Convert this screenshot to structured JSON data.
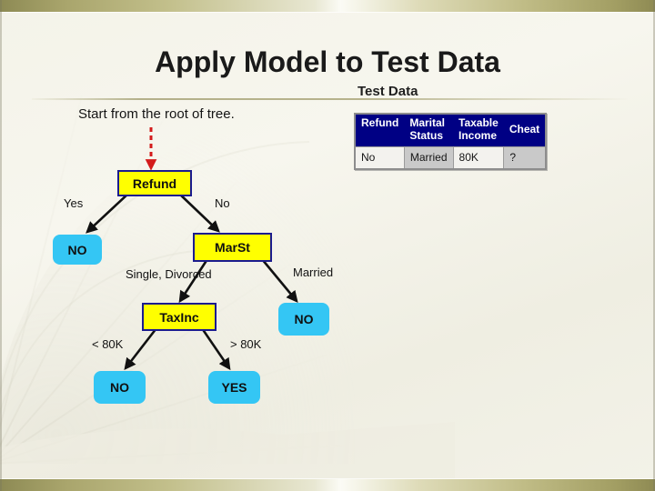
{
  "slide": {
    "title": "Apply Model to Test Data",
    "subtitle": "Test Data",
    "note": "Start from the root of tree.",
    "colors": {
      "background": "#f4f3e9",
      "band": "#a9a56c",
      "decision_fill": "#ffff00",
      "decision_border": "#1b1b8f",
      "leaf_fill": "#34c6f4",
      "table_header_fill": "#000084",
      "table_header_text": "#ffffff",
      "pointer_arrow": "#d31b1b"
    }
  },
  "test_data_table": {
    "headers": [
      "Refund",
      "Marital\nStatus",
      "Taxable\nIncome",
      "Cheat"
    ],
    "rows": [
      [
        "No",
        "Married",
        "80K",
        "?"
      ]
    ]
  },
  "tree": {
    "nodes": [
      {
        "id": "refund",
        "label": "Refund",
        "type": "decision"
      },
      {
        "id": "no-left",
        "label": "NO",
        "type": "leaf"
      },
      {
        "id": "marst",
        "label": "MarSt",
        "type": "decision"
      },
      {
        "id": "taxinc",
        "label": "TaxInc",
        "type": "decision"
      },
      {
        "id": "no-right",
        "label": "NO",
        "type": "leaf"
      },
      {
        "id": "no-bottom",
        "label": "NO",
        "type": "leaf"
      },
      {
        "id": "yes-bottom",
        "label": "YES",
        "type": "leaf"
      }
    ],
    "edge_labels": [
      {
        "id": "yes",
        "label": "Yes"
      },
      {
        "id": "no",
        "label": "No"
      },
      {
        "id": "single-divorced",
        "label": "Single, Divorced"
      },
      {
        "id": "married",
        "label": "Married"
      },
      {
        "id": "lt80k",
        "label": "< 80K"
      },
      {
        "id": "gt80k",
        "label": "> 80K"
      }
    ]
  }
}
